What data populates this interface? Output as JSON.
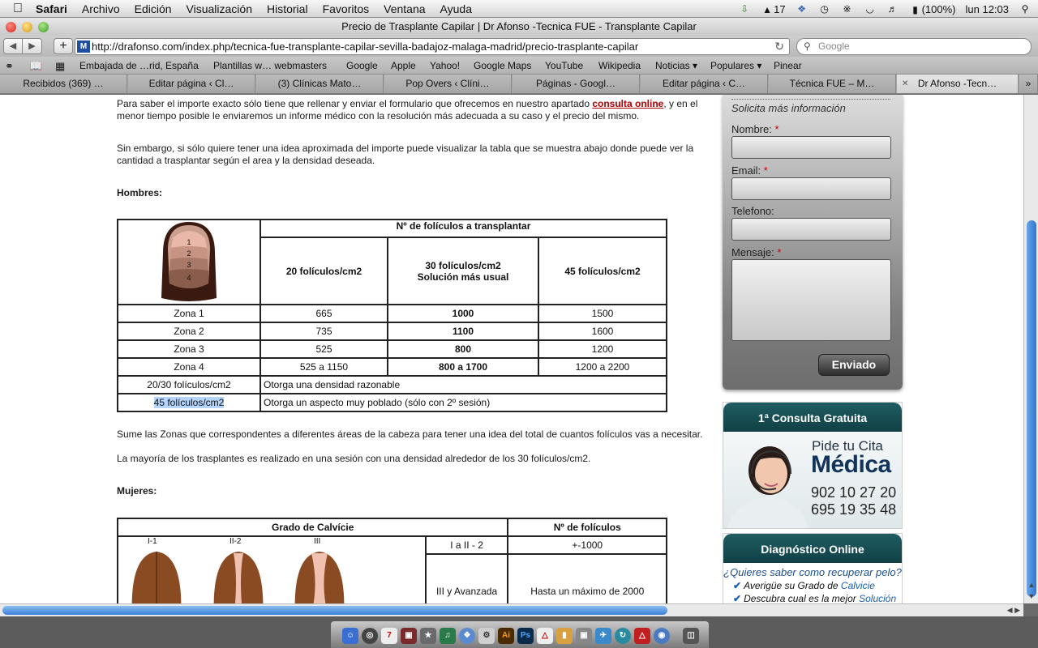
{
  "menubar": {
    "app": "Safari",
    "menus": [
      "Archivo",
      "Edición",
      "Visualización",
      "Historial",
      "Favoritos",
      "Ventana",
      "Ayuda"
    ],
    "status_number": "17",
    "battery": "(100%)",
    "clock": "lun 12:03"
  },
  "window": {
    "title": "Precio de Trasplante Capilar | Dr Afonso -Tecnica FUE - Transplante Capilar"
  },
  "toolbar": {
    "url": "http://drafonso.com/index.php/tecnica-fue-transplante-capilar-sevilla-badajoz-malaga-madrid/precio-trasplante-capilar",
    "favicon_text": "M",
    "search_placeholder": "Google"
  },
  "bookmarks": [
    "Embajada de …rid, España",
    "Plantillas w… webmasters",
    "Google",
    "Apple",
    "Yahoo!",
    "Google Maps",
    "YouTube",
    "Wikipedia",
    "Noticias ▾",
    "Populares ▾",
    "Pinear"
  ],
  "tabs": [
    {
      "label": "Recibidos (369) …",
      "active": false
    },
    {
      "label": "Editar página ‹ Cl…",
      "active": false
    },
    {
      "label": "(3) Clínicas Mato…",
      "active": false
    },
    {
      "label": "Pop Overs ‹ Clíni…",
      "active": false
    },
    {
      "label": "Páginas - Googl…",
      "active": false
    },
    {
      "label": "Editar página ‹ C…",
      "active": false
    },
    {
      "label": "Técnica FUE – M…",
      "active": false
    },
    {
      "label": "Dr Afonso -Tecn…",
      "active": true
    }
  ],
  "content": {
    "p1_before": "Para saber el importe exacto sólo tiene que rellenar y enviar el formulario que ofrecemos en nuestro apartado ",
    "p1_link": "consulta online",
    "p1_after": ", y en el menor tiempo posible le enviaremos un informe médico con la resolución más adecuada a su caso y el precio del mismo.",
    "p2": "Sin embargo, si sólo quiere tener una idea aproximada del importe puede visualizar la tabla que se muestra abajo donde puede ver la cantidad a trasplantar según el area y la densidad deseada.",
    "hombres": "Hombres:",
    "men_table": {
      "header_main": "Nº de folículos a transplantar",
      "col1": "20 folículos/cm2",
      "col2_line1": "30 folículos/cm2",
      "col2_line2": "Solución más usual",
      "col3": "45 folículos/cm2",
      "zone_labels": [
        "1",
        "2",
        "3",
        "4"
      ],
      "rows": [
        {
          "zone": "Zona 1",
          "a": "665",
          "b": "1000",
          "c": "1500"
        },
        {
          "zone": "Zona 2",
          "a": "735",
          "b": "1100",
          "c": "1600"
        },
        {
          "zone": "Zona 3",
          "a": "525",
          "b": "800",
          "c": "1200"
        },
        {
          "zone": "Zona 4",
          "a": "525 a 1150",
          "b": "800 a 1700",
          "c": "1200 a 2200"
        }
      ],
      "note1_key": "20/30 folículos/cm2",
      "note1_val": "Otorga una densidad razonable",
      "note2_key": "45 folículos/cm2",
      "note2_val": "Otorga un aspecto muy poblado (sólo con 2º sesión)"
    },
    "p3": "Sume las Zonas que correspondentes a diferentes áreas de la cabeza para tener una idea del total de cuantos folículos vas a necesitar.",
    "p4": "La mayoría de los trasplantes es realizado en una sesión con una densidad alrededor de los 30 folículos/cm2.",
    "mujeres": "Mujeres:",
    "women_table": {
      "header_grade": "Grado de Calvície",
      "header_count": "Nº de folículos",
      "grades": [
        "I-1",
        "II-2",
        "III"
      ],
      "rows": [
        {
          "grade": "I a II - 2",
          "count": "+-1000"
        },
        {
          "grade": "III y Avanzada",
          "count": "Hasta un máximo de 2000"
        }
      ]
    }
  },
  "sidebar": {
    "form_title": "Solicita más información",
    "name_label": "Nombre:",
    "email_label": "Email:",
    "phone_label": "Telefono:",
    "message_label": "Mensaje:",
    "required_mark": "*",
    "submit": "Enviado",
    "consulta_title": "1ª Consulta Gratuita",
    "pide": "Pide tu Cita",
    "medica": "Médica",
    "phone1": "902 10 27 20",
    "phone2": "695 19 35 48",
    "diag_title": "Diagnóstico Online",
    "diag_question": "¿Quieres saber como recuperar pelo?",
    "diag_item1_text": "Averigüe su Grado de ",
    "diag_item1_link": "Calvicie",
    "diag_item2_text": "Descubra cual es la mejor ",
    "diag_item2_link": "Solución"
  },
  "dock": {
    "labels": [
      "7",
      "Ai",
      "Ps"
    ]
  }
}
